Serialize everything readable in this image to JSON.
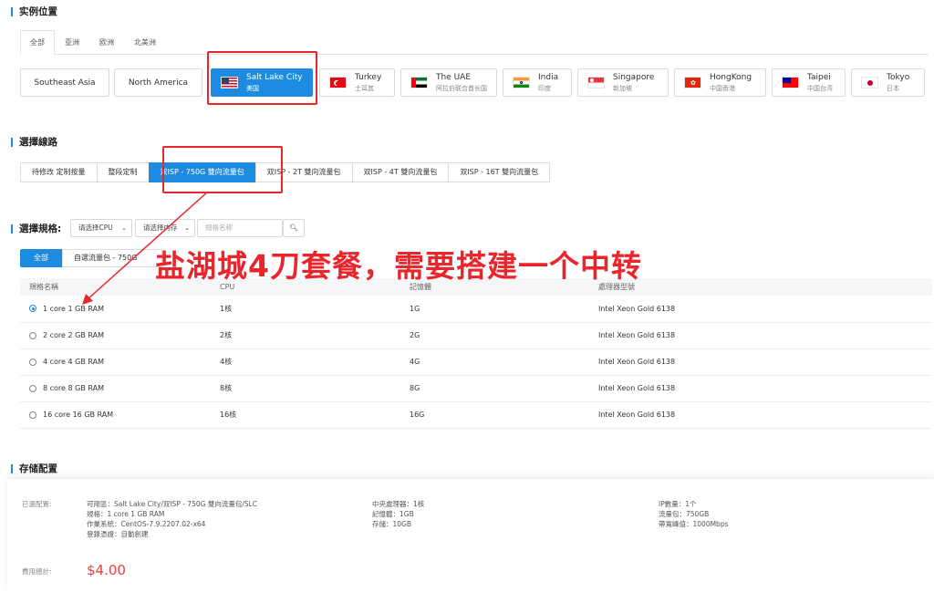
{
  "location": {
    "title": "实例位置",
    "tabs": [
      "全部",
      "亚洲",
      "欧洲",
      "北美洲"
    ],
    "regions": [
      {
        "name": "Southeast Asia",
        "sub": ""
      },
      {
        "name": "North America",
        "sub": ""
      },
      {
        "name": "Salt Lake City",
        "sub": "美国"
      },
      {
        "name": "Turkey",
        "sub": "土耳其"
      },
      {
        "name": "The UAE",
        "sub": "阿拉伯联合酋长国"
      },
      {
        "name": "India",
        "sub": "印度"
      },
      {
        "name": "Singapore",
        "sub": "新加坡"
      },
      {
        "name": "HongKong",
        "sub": "中国香港"
      },
      {
        "name": "Taipei",
        "sub": "中国台湾"
      },
      {
        "name": "Tokyo",
        "sub": "日本"
      }
    ]
  },
  "line": {
    "title": "選擇線路",
    "options": [
      "待修改 定制按量",
      "整段定制",
      "双ISP - 750G 雙向流量包",
      "双ISP - 2T 雙向流量包",
      "双ISP - 4T 雙向流量包",
      "双ISP - 16T 雙向流量包"
    ]
  },
  "spec": {
    "title": "選擇規格:",
    "cpu_select": "请选择CPU",
    "mem_select": "请选择内存",
    "name_placeholder": "规格名称",
    "tabs": [
      "全部",
      "自選流量包 - 750G"
    ],
    "columns": [
      "規格名稱",
      "CPU",
      "記憶體",
      "處理器型號"
    ],
    "rows": [
      {
        "name": "1 core 1 GB RAM",
        "cpu": "1核",
        "mem": "1G",
        "proc": "Intel Xeon Gold 6138"
      },
      {
        "name": "2 core 2 GB RAM",
        "cpu": "2核",
        "mem": "2G",
        "proc": "Intel Xeon Gold 6138"
      },
      {
        "name": "4 core 4 GB RAM",
        "cpu": "4核",
        "mem": "4G",
        "proc": "Intel Xeon Gold 6138"
      },
      {
        "name": "8 core 8 GB RAM",
        "cpu": "8核",
        "mem": "8G",
        "proc": "Intel Xeon Gold 6138"
      },
      {
        "name": "16 core 16 GB RAM",
        "cpu": "16核",
        "mem": "16G",
        "proc": "Intel Xeon Gold 6138"
      }
    ]
  },
  "annotation": "盐湖城4刀套餐，需要搭建一个中转",
  "storage": {
    "title": "存储配置"
  },
  "summary": {
    "label": "已選配置:",
    "col1": [
      "可用區：Salt Lake City/双ISP - 750G 雙向流量包/SLC",
      "規格：1 core 1 GB RAM",
      "作業系統：CentOS-7.9.2207.02-x64",
      "登錄憑證：自動創建"
    ],
    "col2": [
      "中央處理器：1核",
      "記憶體：1GB",
      "存儲：10GB"
    ],
    "col3": [
      "IP數量：1个",
      "流量包：750GB",
      "帶寬峰值：1000Mbps"
    ],
    "price_label": "費用總計:",
    "price": "$4.00"
  },
  "colors": {
    "accent": "#1d8ce0",
    "highlight": "#e8262c",
    "price": "#e8403b"
  }
}
